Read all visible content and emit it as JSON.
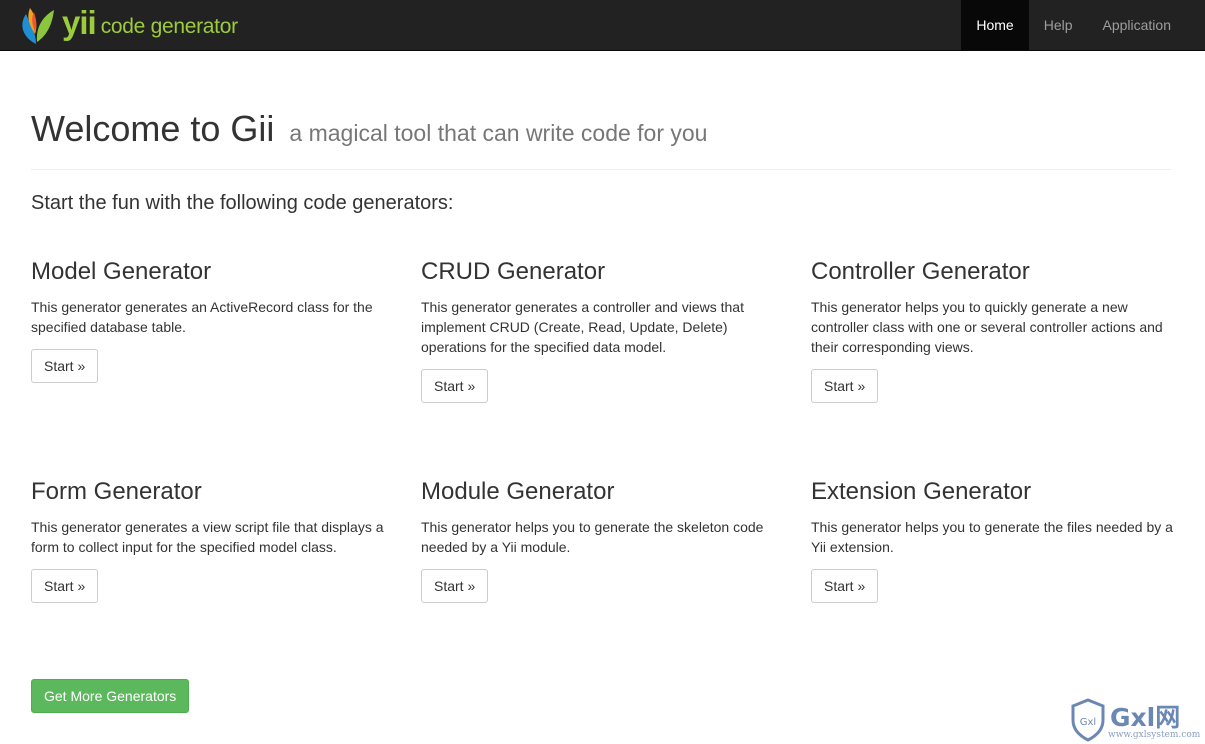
{
  "navbar": {
    "brand_yii": "yii",
    "brand_text": "code generator",
    "items": [
      {
        "label": "Home",
        "active": true
      },
      {
        "label": "Help",
        "active": false
      },
      {
        "label": "Application",
        "active": false
      }
    ]
  },
  "header": {
    "title": "Welcome to Gii",
    "subtitle": "a magical tool that can write code for you"
  },
  "lead": "Start the fun with the following code generators:",
  "generators": [
    {
      "title": "Model Generator",
      "description": "This generator generates an ActiveRecord class for the specified database table.",
      "button": "Start »"
    },
    {
      "title": "CRUD Generator",
      "description": "This generator generates a controller and views that implement CRUD (Create, Read, Update, Delete) operations for the specified data model.",
      "button": "Start »"
    },
    {
      "title": "Controller Generator",
      "description": "This generator helps you to quickly generate a new controller class with one or several controller actions and their corresponding views.",
      "button": "Start »"
    },
    {
      "title": "Form Generator",
      "description": "This generator generates a view script file that displays a form to collect input for the specified model class.",
      "button": "Start »"
    },
    {
      "title": "Module Generator",
      "description": "This generator helps you to generate the skeleton code needed by a Yii module.",
      "button": "Start »"
    },
    {
      "title": "Extension Generator",
      "description": "This generator helps you to generate the files needed by a Yii extension.",
      "button": "Start »"
    }
  ],
  "more_button": "Get More Generators",
  "watermark": {
    "shield_text": "Gxl",
    "text": "Gxl网",
    "url": "www.gxlsystem.com"
  },
  "colors": {
    "navbar_bg": "#222222",
    "brand_green": "#9ccb3b",
    "success": "#5cb85c"
  }
}
